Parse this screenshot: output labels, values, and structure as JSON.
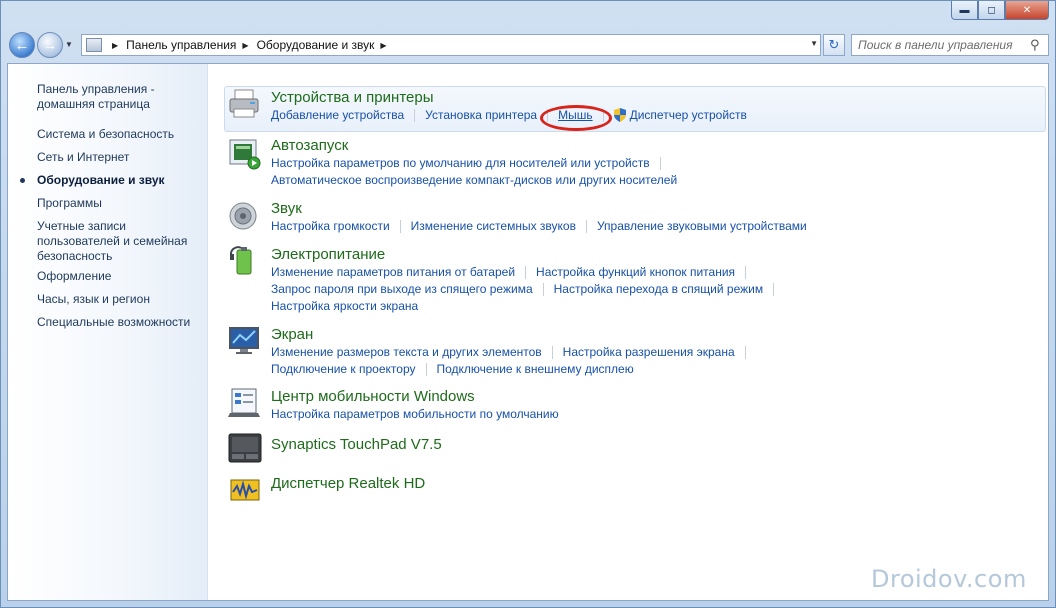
{
  "window": {
    "minimize_glyph": "▬",
    "maximize_glyph": "◻",
    "close_glyph": "✕"
  },
  "navigation": {
    "breadcrumbs": [
      "Панель управления",
      "Оборудование и звук"
    ],
    "search_placeholder": "Поиск в панели управления"
  },
  "sidebar": {
    "items": [
      {
        "label": "Панель управления - домашняя страница",
        "active": false
      },
      {
        "label": "Система и безопасность",
        "active": false
      },
      {
        "label": "Сеть и Интернет",
        "active": false
      },
      {
        "label": "Оборудование и звук",
        "active": true
      },
      {
        "label": "Программы",
        "active": false
      },
      {
        "label": "Учетные записи пользователей и семейная безопасность",
        "active": false
      },
      {
        "label": "Оформление",
        "active": false
      },
      {
        "label": "Часы, язык и регион",
        "active": false
      },
      {
        "label": "Специальные возможности",
        "active": false
      }
    ]
  },
  "categories": [
    {
      "title": "Устройства и принтеры",
      "icon": "printer-icon",
      "rows": [
        [
          "Добавление устройства",
          "Установка принтера",
          "Мышь",
          "Диспетчер устройств"
        ]
      ]
    },
    {
      "title": "Автозапуск",
      "icon": "autoplay-icon",
      "rows": [
        [
          "Настройка параметров по умолчанию для носителей или устройств"
        ],
        [
          "Автоматическое воспроизведение компакт-дисков или других носителей"
        ]
      ]
    },
    {
      "title": "Звук",
      "icon": "speaker-icon",
      "rows": [
        [
          "Настройка громкости",
          "Изменение системных звуков",
          "Управление звуковыми устройствами"
        ]
      ]
    },
    {
      "title": "Электропитание",
      "icon": "battery-icon",
      "rows": [
        [
          "Изменение параметров питания от батарей",
          "Настройка функций кнопок питания"
        ],
        [
          "Запрос пароля при выходе из спящего режима",
          "Настройка перехода в спящий режим"
        ],
        [
          "Настройка яркости экрана"
        ]
      ]
    },
    {
      "title": "Экран",
      "icon": "monitor-icon",
      "rows": [
        [
          "Изменение размеров текста и других элементов",
          "Настройка разрешения экрана"
        ],
        [
          "Подключение к проектору",
          "Подключение к внешнему дисплею"
        ]
      ]
    },
    {
      "title": "Центр мобильности Windows",
      "icon": "mobility-center-icon",
      "rows": [
        [
          "Настройка параметров мобильности по умолчанию"
        ]
      ]
    },
    {
      "title": "Synaptics TouchPad V7.5",
      "icon": "touchpad-icon",
      "rows": []
    },
    {
      "title": "Диспетчер Realtek HD",
      "icon": "realtek-audio-icon",
      "rows": []
    }
  ],
  "watermark": "Droidov.com",
  "colors": {
    "category_title": "#1e6b1b",
    "link": "#1851a8",
    "highlight_circle": "#d8231a"
  }
}
